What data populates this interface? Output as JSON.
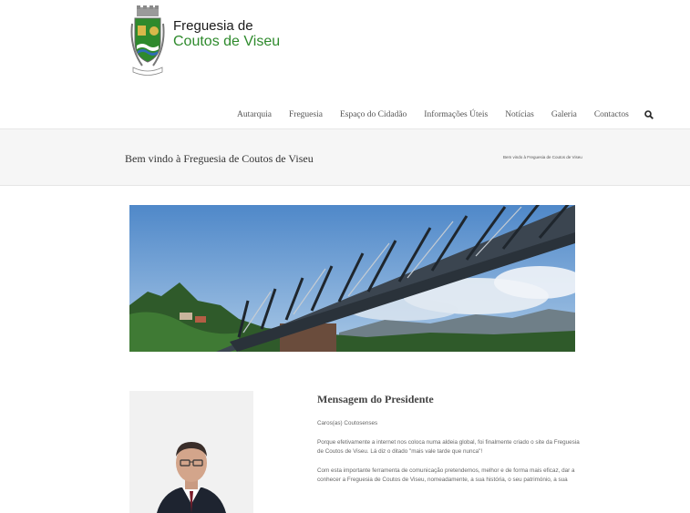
{
  "brand": {
    "line1": "Freguesia de",
    "line2": "Coutos de Viseu",
    "logo_icon": "coat-of-arms-icon",
    "accent_color": "#2e8a2c"
  },
  "nav": {
    "items": [
      {
        "label": "Autarquia"
      },
      {
        "label": "Freguesia"
      },
      {
        "label": "Espaço do Cidadão"
      },
      {
        "label": "Informações Úteis"
      },
      {
        "label": "Notícias"
      },
      {
        "label": "Galeria"
      },
      {
        "label": "Contactos"
      }
    ],
    "search_icon": "search-icon"
  },
  "titlebar": {
    "title": "Bem vindo à Freguesia de Coutos de Viseu",
    "breadcrumb": "Bem vindo à Freguesia de Coutos de Viseu"
  },
  "president": {
    "heading": "Mensagem do Presidente",
    "paragraphs": [
      "Caros(as) Coutosenses",
      "Porque efetivamente a internet nos coloca numa aldeia global, foi finalmente criado o site da Freguesia de Coutos de Viseu. Lá diz o ditado \"mais vale tarde que nunca\"!",
      "Com esta importante ferramenta de comunicação pretendemos, melhor e de forma mais eficaz, dar a conhecer a Freguesia de Coutos de Viseu, nomeadamente, a sua história, o seu património, a sua"
    ]
  }
}
